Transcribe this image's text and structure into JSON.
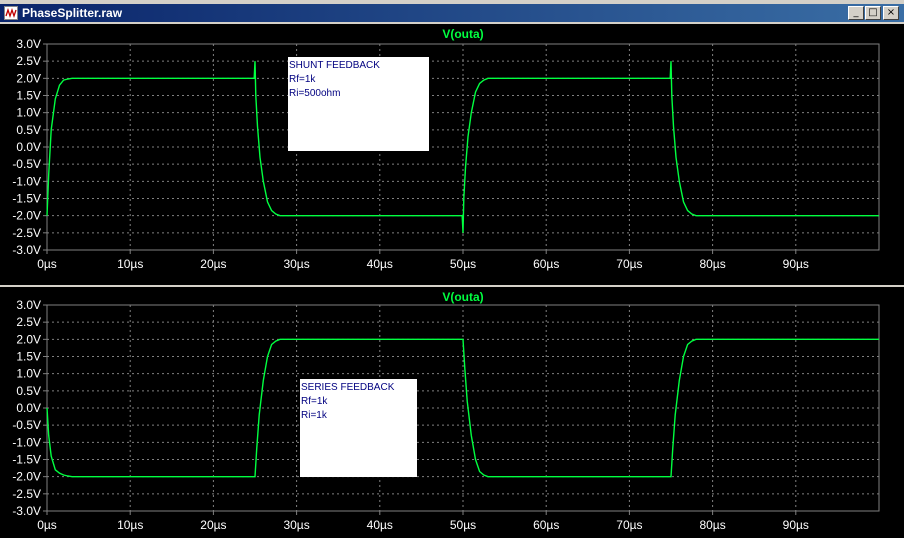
{
  "window": {
    "title": "PhaseSplitter.raw",
    "minimize": "_",
    "restore": "□",
    "close": "×"
  },
  "colors": {
    "plot_bg": "#000000",
    "grid": "#808080",
    "trace": "#00ff40",
    "axis_text": "#ffffff",
    "note_bg": "#ffffff",
    "note_text": "#000080"
  },
  "chart_data": [
    {
      "type": "line",
      "title": "V(outa)",
      "xlabel": "",
      "ylabel": "",
      "xlim": [
        0,
        100
      ],
      "ylim": [
        -3.0,
        3.0
      ],
      "xticks": [
        "0µs",
        "10µs",
        "20µs",
        "30µs",
        "40µs",
        "50µs",
        "60µs",
        "70µs",
        "80µs",
        "90µs"
      ],
      "yticks": [
        "3.0V",
        "2.5V",
        "2.0V",
        "1.5V",
        "1.0V",
        "0.5V",
        "0.0V",
        "-0.5V",
        "-1.0V",
        "-1.5V",
        "-2.0V",
        "-2.5V",
        "-3.0V"
      ],
      "grid": true,
      "annotation": [
        "SHUNT FEEDBACK",
        "Rf=1k",
        "Ri=500ohm"
      ],
      "series": [
        {
          "x": [
            0,
            0.2,
            0.5,
            1,
            1.5,
            2,
            2.5,
            3,
            24.9,
            25,
            25.1,
            25.3,
            25.6,
            26,
            26.5,
            27,
            27.5,
            28,
            49.9,
            50,
            50.1,
            50.3,
            50.6,
            51,
            51.5,
            52,
            52.5,
            53,
            74.9,
            75,
            75.1,
            75.3,
            75.6,
            76,
            76.5,
            77,
            77.5,
            78,
            100
          ],
          "y": [
            -2.0,
            -0.8,
            0.5,
            1.4,
            1.8,
            1.95,
            1.98,
            2.0,
            2.0,
            2.5,
            1.5,
            0.6,
            -0.3,
            -1.0,
            -1.6,
            -1.85,
            -1.95,
            -2.0,
            -2.0,
            -2.5,
            -1.5,
            -0.6,
            0.3,
            1.0,
            1.6,
            1.85,
            1.95,
            2.0,
            2.0,
            2.5,
            1.5,
            0.6,
            -0.3,
            -1.0,
            -1.6,
            -1.85,
            -1.95,
            -2.0,
            -2.0
          ]
        }
      ]
    },
    {
      "type": "line",
      "title": "V(outa)",
      "xlabel": "",
      "ylabel": "",
      "xlim": [
        0,
        100
      ],
      "ylim": [
        -3.0,
        3.0
      ],
      "xticks": [
        "0µs",
        "10µs",
        "20µs",
        "30µs",
        "40µs",
        "50µs",
        "60µs",
        "70µs",
        "80µs",
        "90µs"
      ],
      "yticks": [
        "3.0V",
        "2.5V",
        "2.0V",
        "1.5V",
        "1.0V",
        "0.5V",
        "0.0V",
        "-0.5V",
        "-1.0V",
        "-1.5V",
        "-2.0V",
        "-2.5V",
        "-3.0V"
      ],
      "grid": true,
      "annotation": [
        "SERIES FEEDBACK",
        "Rf=1k",
        "Ri=1k"
      ],
      "series": [
        {
          "x": [
            0,
            0.2,
            0.5,
            1,
            1.5,
            2,
            2.5,
            3,
            25,
            25.2,
            25.5,
            26,
            26.5,
            27,
            27.5,
            28,
            50,
            50.2,
            50.5,
            51,
            51.5,
            52,
            52.5,
            53,
            75,
            75.2,
            75.5,
            76,
            76.5,
            77,
            77.5,
            78,
            100
          ],
          "y": [
            0.0,
            -0.8,
            -1.4,
            -1.8,
            -1.9,
            -1.95,
            -1.98,
            -2.0,
            -2.0,
            -1.2,
            -0.2,
            0.8,
            1.5,
            1.85,
            1.95,
            2.0,
            2.0,
            1.2,
            0.2,
            -0.8,
            -1.5,
            -1.85,
            -1.95,
            -2.0,
            -2.0,
            -1.2,
            -0.2,
            0.8,
            1.5,
            1.85,
            1.95,
            2.0,
            2.0
          ]
        }
      ]
    }
  ]
}
